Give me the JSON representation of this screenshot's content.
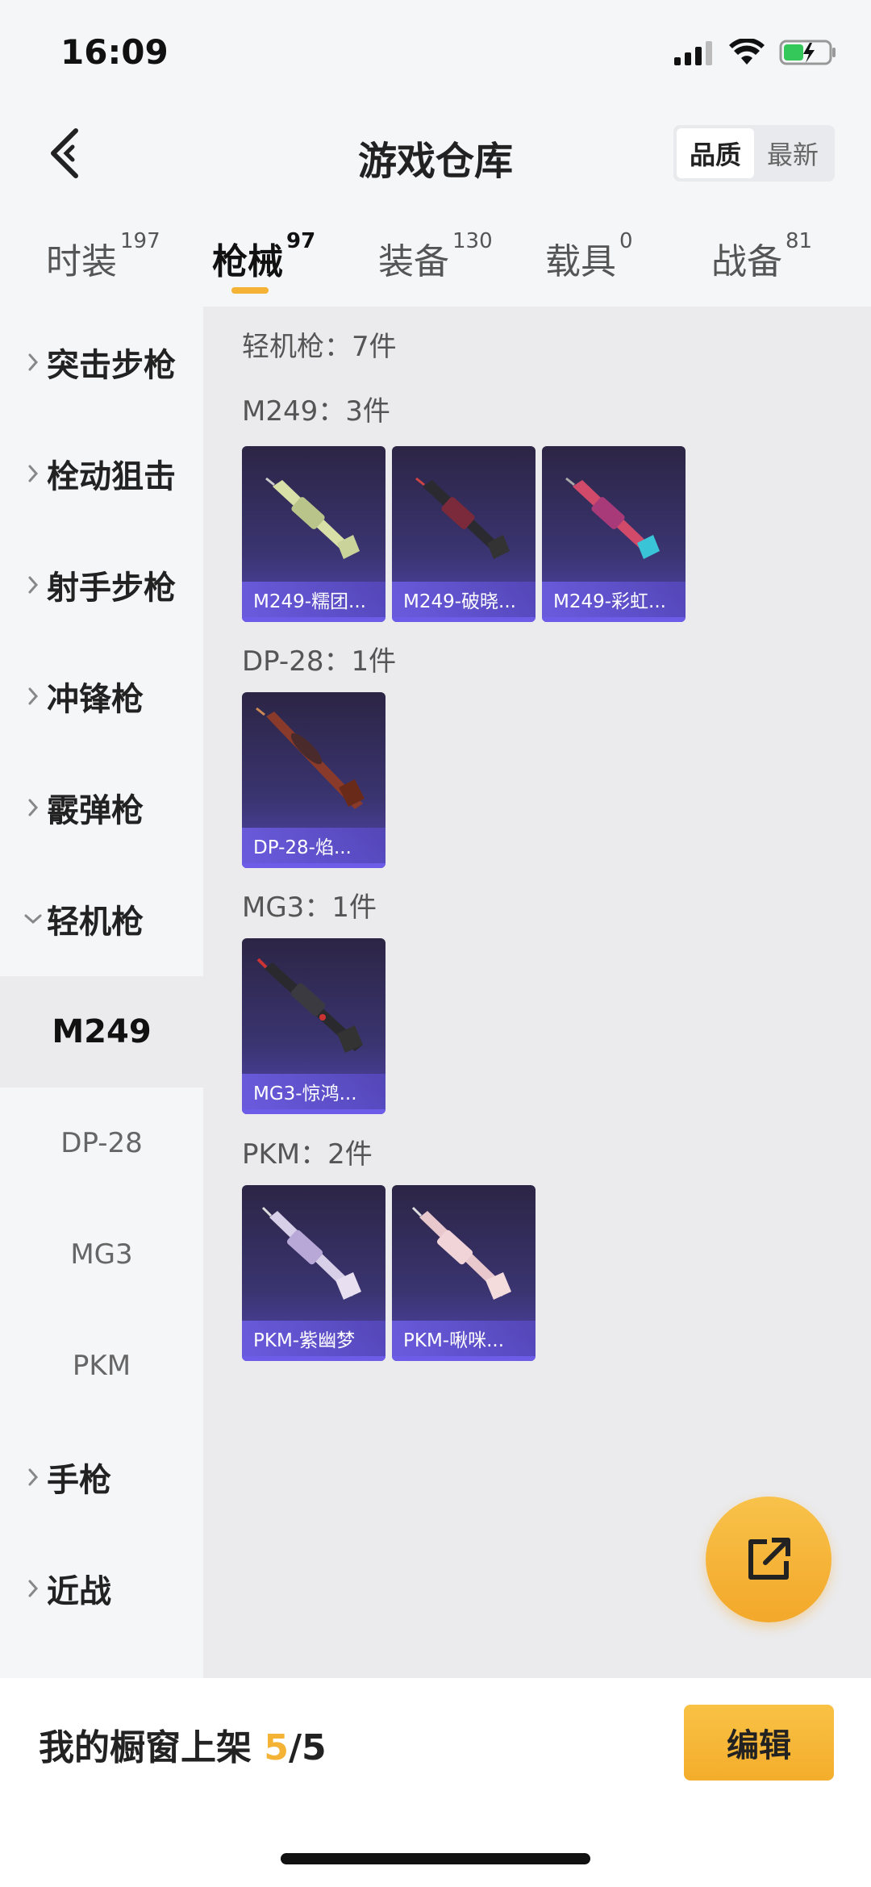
{
  "status_bar": {
    "time": "16:09"
  },
  "header": {
    "title": "游戏仓库",
    "sort_options": [
      "品质",
      "最新"
    ],
    "sort_active": "品质"
  },
  "tabs": [
    {
      "label": "时装",
      "count": "197"
    },
    {
      "label": "枪械",
      "count": "97"
    },
    {
      "label": "装备",
      "count": "130"
    },
    {
      "label": "载具",
      "count": "0"
    },
    {
      "label": "战备",
      "count": "81"
    }
  ],
  "active_tab": "枪械",
  "sidebar": {
    "categories": [
      {
        "label": "突击步枪"
      },
      {
        "label": "栓动狙击"
      },
      {
        "label": "射手步枪"
      },
      {
        "label": "冲锋枪"
      },
      {
        "label": "霰弹枪"
      },
      {
        "label": "轻机枪"
      }
    ],
    "subitems": [
      {
        "label": "M249"
      },
      {
        "label": "DP-28"
      },
      {
        "label": "MG3"
      },
      {
        "label": "PKM"
      }
    ],
    "active_sub": "M249",
    "trailing": [
      {
        "label": "手枪"
      },
      {
        "label": "近战"
      }
    ]
  },
  "main": {
    "summary": "轻机枪：7件",
    "groups": [
      {
        "title": "M249：3件",
        "items": [
          "M249-糯团...",
          "M249-破晓...",
          "M249-彩虹..."
        ]
      },
      {
        "title": "DP-28：1件",
        "items": [
          "DP-28-焰..."
        ]
      },
      {
        "title": "MG3：1件",
        "items": [
          "MG3-惊鸿..."
        ]
      },
      {
        "title": "PKM：2件",
        "items": [
          "PKM-紫幽梦",
          "PKM-啾咪..."
        ]
      }
    ]
  },
  "footer": {
    "label_prefix": "我的橱窗上架 ",
    "count": "5",
    "total": "/5",
    "edit_label": "编辑"
  },
  "colors": {
    "accent": "#f5b335",
    "card_bg": "#3a3470",
    "card_band": "#6c5ce7"
  }
}
